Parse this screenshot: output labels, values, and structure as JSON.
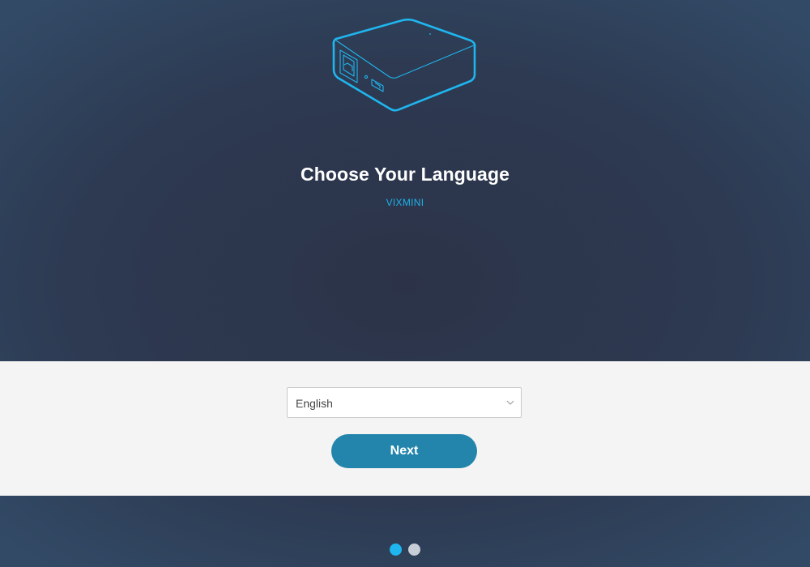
{
  "header": {
    "title": "Choose Your Language",
    "subtitle": "VIXMINI",
    "device_icon": "network-device-icon"
  },
  "language_select": {
    "selected_value": "English",
    "icon": "chevron-down-icon"
  },
  "actions": {
    "next_label": "Next"
  },
  "pagination": {
    "current_step": 1,
    "total_steps": 2
  },
  "colors": {
    "accent": "#1fb1ec",
    "button": "#2385ab",
    "background_dark": "#2c3348",
    "panel": "#f4f4f4"
  }
}
